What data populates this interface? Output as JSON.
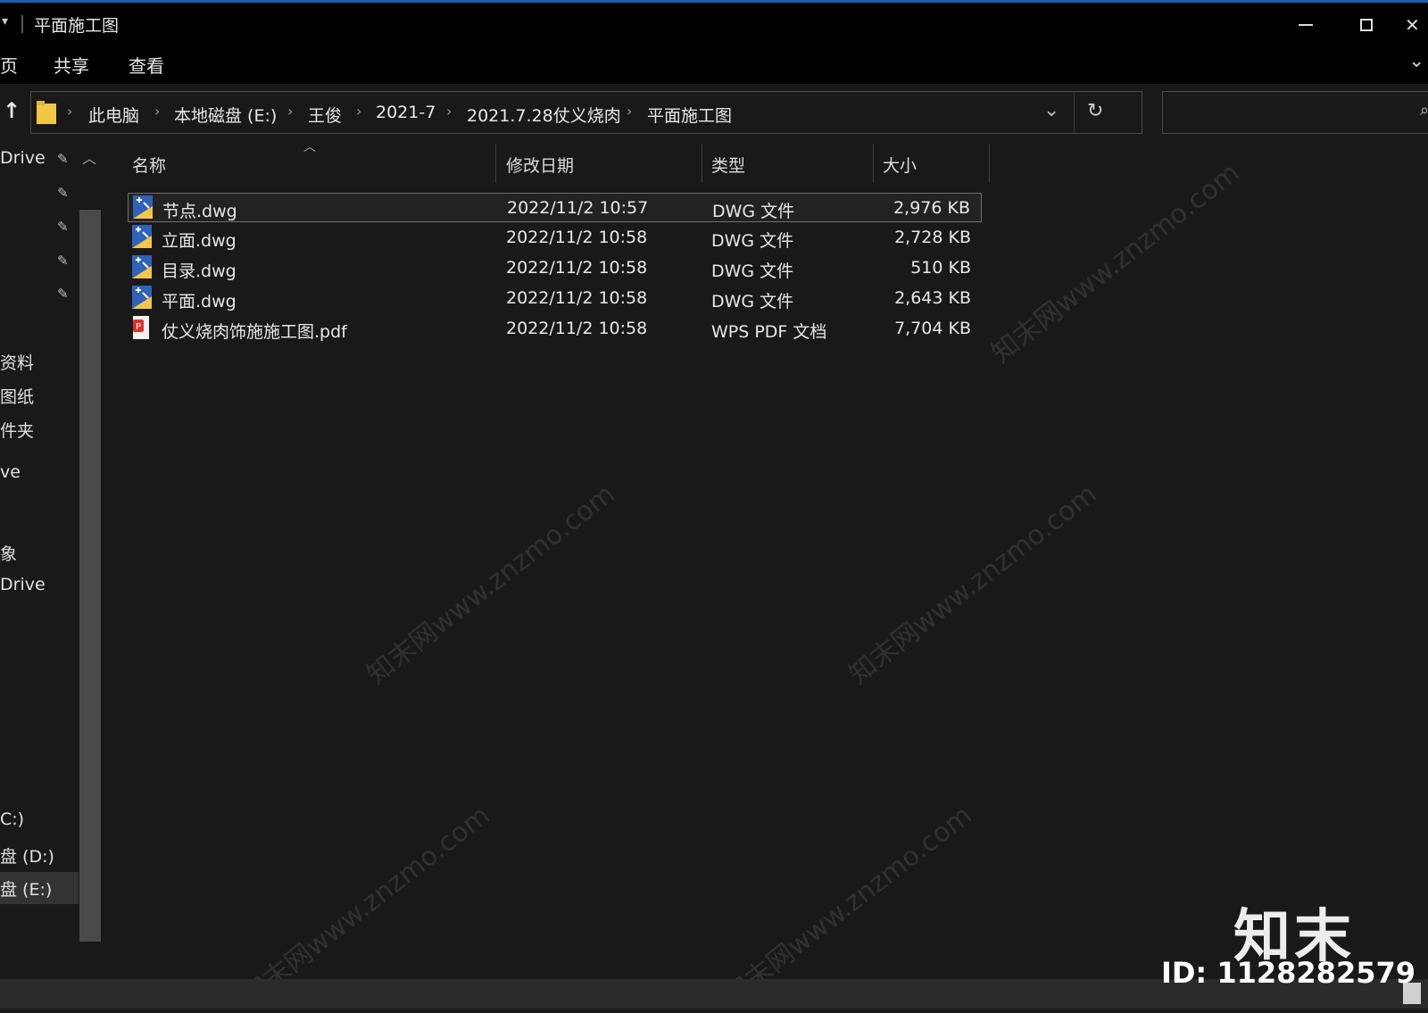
{
  "window": {
    "title": "平面施工图",
    "minimize_icon": "minimize-icon",
    "maximize_icon": "maximize-icon",
    "close_icon": "close-icon"
  },
  "ribbon": {
    "tabs": [
      {
        "label": "页"
      },
      {
        "label": "共享"
      },
      {
        "label": "查看"
      }
    ]
  },
  "address": {
    "crumbs": [
      {
        "label": "此电脑"
      },
      {
        "label": "本地磁盘 (E:)"
      },
      {
        "label": "王俊"
      },
      {
        "label": "2021-7"
      },
      {
        "label": "2021.7.28仗义烧肉"
      },
      {
        "label": "平面施工图"
      }
    ],
    "separator": "›"
  },
  "sidebar": {
    "items": [
      {
        "label": "Drive"
      },
      {
        "label": "资料"
      },
      {
        "label": "图纸"
      },
      {
        "label": "件夹"
      },
      {
        "label": "ve"
      },
      {
        "label": "象"
      },
      {
        "label": "Drive"
      },
      {
        "label": "C:)"
      },
      {
        "label": "盘 (D:)"
      },
      {
        "label": "盘 (E:)"
      }
    ]
  },
  "columns": {
    "name": "名称",
    "date": "修改日期",
    "type": "类型",
    "size": "大小"
  },
  "files": [
    {
      "name": "节点.dwg",
      "date": "2022/11/2 10:57",
      "type": "DWG 文件",
      "size": "2,976 KB",
      "icon": "dwg-file-icon"
    },
    {
      "name": "立面.dwg",
      "date": "2022/11/2 10:58",
      "type": "DWG 文件",
      "size": "2,728 KB",
      "icon": "dwg-file-icon"
    },
    {
      "name": "目录.dwg",
      "date": "2022/11/2 10:58",
      "type": "DWG 文件",
      "size": "510 KB",
      "icon": "dwg-file-icon"
    },
    {
      "name": "平面.dwg",
      "date": "2022/11/2 10:58",
      "type": "DWG 文件",
      "size": "2,643 KB",
      "icon": "dwg-file-icon"
    },
    {
      "name": "仗义烧肉饰施施工图.pdf",
      "date": "2022/11/2 10:58",
      "type": "WPS PDF 文档",
      "size": "7,704 KB",
      "icon": "pdf-file-icon"
    }
  ],
  "watermark": {
    "logo": "知末",
    "id": "ID: 1128282579",
    "text": "知末网www.znzmo.com"
  },
  "colors": {
    "background": "#191919",
    "titlebar": "#000000",
    "selection_border": "#6f6f6f",
    "folder": "#f2c744"
  }
}
